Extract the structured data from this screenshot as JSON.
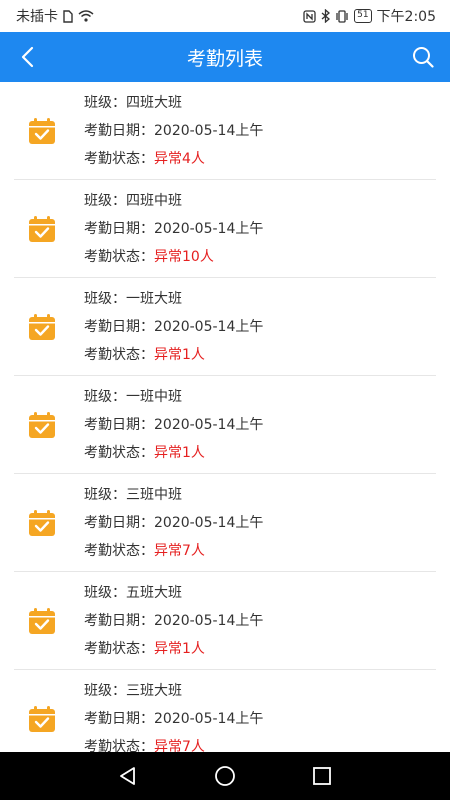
{
  "status_bar": {
    "carrier": "未插卡",
    "battery": "51",
    "time": "下午2:05"
  },
  "app_bar": {
    "title": "考勤列表",
    "back_icon": "chevron-left-icon",
    "search_icon": "search-icon"
  },
  "labels": {
    "class_label": "班级：",
    "date_label": "考勤日期：",
    "status_label": "考勤状态："
  },
  "items": [
    {
      "class_name": "四班大班",
      "date": "2020-05-14上午",
      "status": "异常4人"
    },
    {
      "class_name": "四班中班",
      "date": "2020-05-14上午",
      "status": "异常10人"
    },
    {
      "class_name": "一班大班",
      "date": "2020-05-14上午",
      "status": "异常1人"
    },
    {
      "class_name": "一班中班",
      "date": "2020-05-14上午",
      "status": "异常1人"
    },
    {
      "class_name": "三班中班",
      "date": "2020-05-14上午",
      "status": "异常7人"
    },
    {
      "class_name": "五班大班",
      "date": "2020-05-14上午",
      "status": "异常1人"
    },
    {
      "class_name": "三班大班",
      "date": "2020-05-14上午",
      "status": "异常7人"
    }
  ],
  "colors": {
    "app_bar": "#1e88f0",
    "icon_orange": "#f5a623",
    "alert_red": "#e52020"
  }
}
